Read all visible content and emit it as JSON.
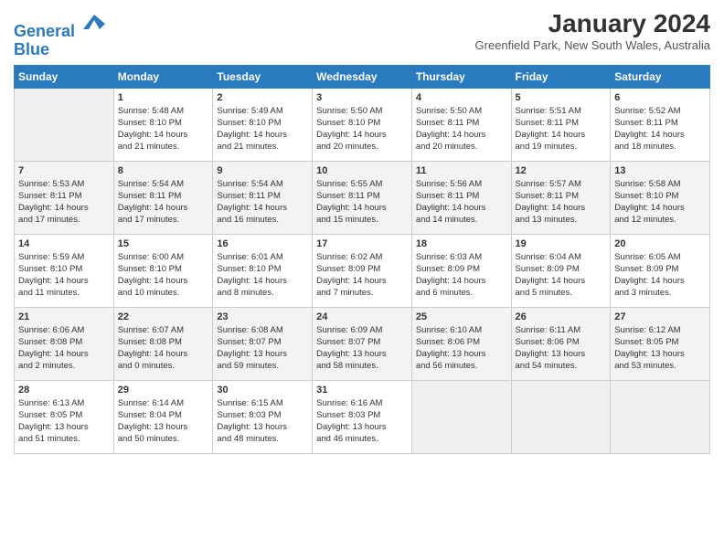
{
  "header": {
    "logo_line1": "General",
    "logo_line2": "Blue",
    "title": "January 2024",
    "subtitle": "Greenfield Park, New South Wales, Australia"
  },
  "days_of_week": [
    "Sunday",
    "Monday",
    "Tuesday",
    "Wednesday",
    "Thursday",
    "Friday",
    "Saturday"
  ],
  "weeks": [
    [
      {
        "day": "",
        "info": ""
      },
      {
        "day": "1",
        "info": "Sunrise: 5:48 AM\nSunset: 8:10 PM\nDaylight: 14 hours\nand 21 minutes."
      },
      {
        "day": "2",
        "info": "Sunrise: 5:49 AM\nSunset: 8:10 PM\nDaylight: 14 hours\nand 21 minutes."
      },
      {
        "day": "3",
        "info": "Sunrise: 5:50 AM\nSunset: 8:10 PM\nDaylight: 14 hours\nand 20 minutes."
      },
      {
        "day": "4",
        "info": "Sunrise: 5:50 AM\nSunset: 8:11 PM\nDaylight: 14 hours\nand 20 minutes."
      },
      {
        "day": "5",
        "info": "Sunrise: 5:51 AM\nSunset: 8:11 PM\nDaylight: 14 hours\nand 19 minutes."
      },
      {
        "day": "6",
        "info": "Sunrise: 5:52 AM\nSunset: 8:11 PM\nDaylight: 14 hours\nand 18 minutes."
      }
    ],
    [
      {
        "day": "7",
        "info": "Sunrise: 5:53 AM\nSunset: 8:11 PM\nDaylight: 14 hours\nand 17 minutes."
      },
      {
        "day": "8",
        "info": "Sunrise: 5:54 AM\nSunset: 8:11 PM\nDaylight: 14 hours\nand 17 minutes."
      },
      {
        "day": "9",
        "info": "Sunrise: 5:54 AM\nSunset: 8:11 PM\nDaylight: 14 hours\nand 16 minutes."
      },
      {
        "day": "10",
        "info": "Sunrise: 5:55 AM\nSunset: 8:11 PM\nDaylight: 14 hours\nand 15 minutes."
      },
      {
        "day": "11",
        "info": "Sunrise: 5:56 AM\nSunset: 8:11 PM\nDaylight: 14 hours\nand 14 minutes."
      },
      {
        "day": "12",
        "info": "Sunrise: 5:57 AM\nSunset: 8:11 PM\nDaylight: 14 hours\nand 13 minutes."
      },
      {
        "day": "13",
        "info": "Sunrise: 5:58 AM\nSunset: 8:10 PM\nDaylight: 14 hours\nand 12 minutes."
      }
    ],
    [
      {
        "day": "14",
        "info": "Sunrise: 5:59 AM\nSunset: 8:10 PM\nDaylight: 14 hours\nand 11 minutes."
      },
      {
        "day": "15",
        "info": "Sunrise: 6:00 AM\nSunset: 8:10 PM\nDaylight: 14 hours\nand 10 minutes."
      },
      {
        "day": "16",
        "info": "Sunrise: 6:01 AM\nSunset: 8:10 PM\nDaylight: 14 hours\nand 8 minutes."
      },
      {
        "day": "17",
        "info": "Sunrise: 6:02 AM\nSunset: 8:09 PM\nDaylight: 14 hours\nand 7 minutes."
      },
      {
        "day": "18",
        "info": "Sunrise: 6:03 AM\nSunset: 8:09 PM\nDaylight: 14 hours\nand 6 minutes."
      },
      {
        "day": "19",
        "info": "Sunrise: 6:04 AM\nSunset: 8:09 PM\nDaylight: 14 hours\nand 5 minutes."
      },
      {
        "day": "20",
        "info": "Sunrise: 6:05 AM\nSunset: 8:09 PM\nDaylight: 14 hours\nand 3 minutes."
      }
    ],
    [
      {
        "day": "21",
        "info": "Sunrise: 6:06 AM\nSunset: 8:08 PM\nDaylight: 14 hours\nand 2 minutes."
      },
      {
        "day": "22",
        "info": "Sunrise: 6:07 AM\nSunset: 8:08 PM\nDaylight: 14 hours\nand 0 minutes."
      },
      {
        "day": "23",
        "info": "Sunrise: 6:08 AM\nSunset: 8:07 PM\nDaylight: 13 hours\nand 59 minutes."
      },
      {
        "day": "24",
        "info": "Sunrise: 6:09 AM\nSunset: 8:07 PM\nDaylight: 13 hours\nand 58 minutes."
      },
      {
        "day": "25",
        "info": "Sunrise: 6:10 AM\nSunset: 8:06 PM\nDaylight: 13 hours\nand 56 minutes."
      },
      {
        "day": "26",
        "info": "Sunrise: 6:11 AM\nSunset: 8:06 PM\nDaylight: 13 hours\nand 54 minutes."
      },
      {
        "day": "27",
        "info": "Sunrise: 6:12 AM\nSunset: 8:05 PM\nDaylight: 13 hours\nand 53 minutes."
      }
    ],
    [
      {
        "day": "28",
        "info": "Sunrise: 6:13 AM\nSunset: 8:05 PM\nDaylight: 13 hours\nand 51 minutes."
      },
      {
        "day": "29",
        "info": "Sunrise: 6:14 AM\nSunset: 8:04 PM\nDaylight: 13 hours\nand 50 minutes."
      },
      {
        "day": "30",
        "info": "Sunrise: 6:15 AM\nSunset: 8:03 PM\nDaylight: 13 hours\nand 48 minutes."
      },
      {
        "day": "31",
        "info": "Sunrise: 6:16 AM\nSunset: 8:03 PM\nDaylight: 13 hours\nand 46 minutes."
      },
      {
        "day": "",
        "info": ""
      },
      {
        "day": "",
        "info": ""
      },
      {
        "day": "",
        "info": ""
      }
    ]
  ]
}
